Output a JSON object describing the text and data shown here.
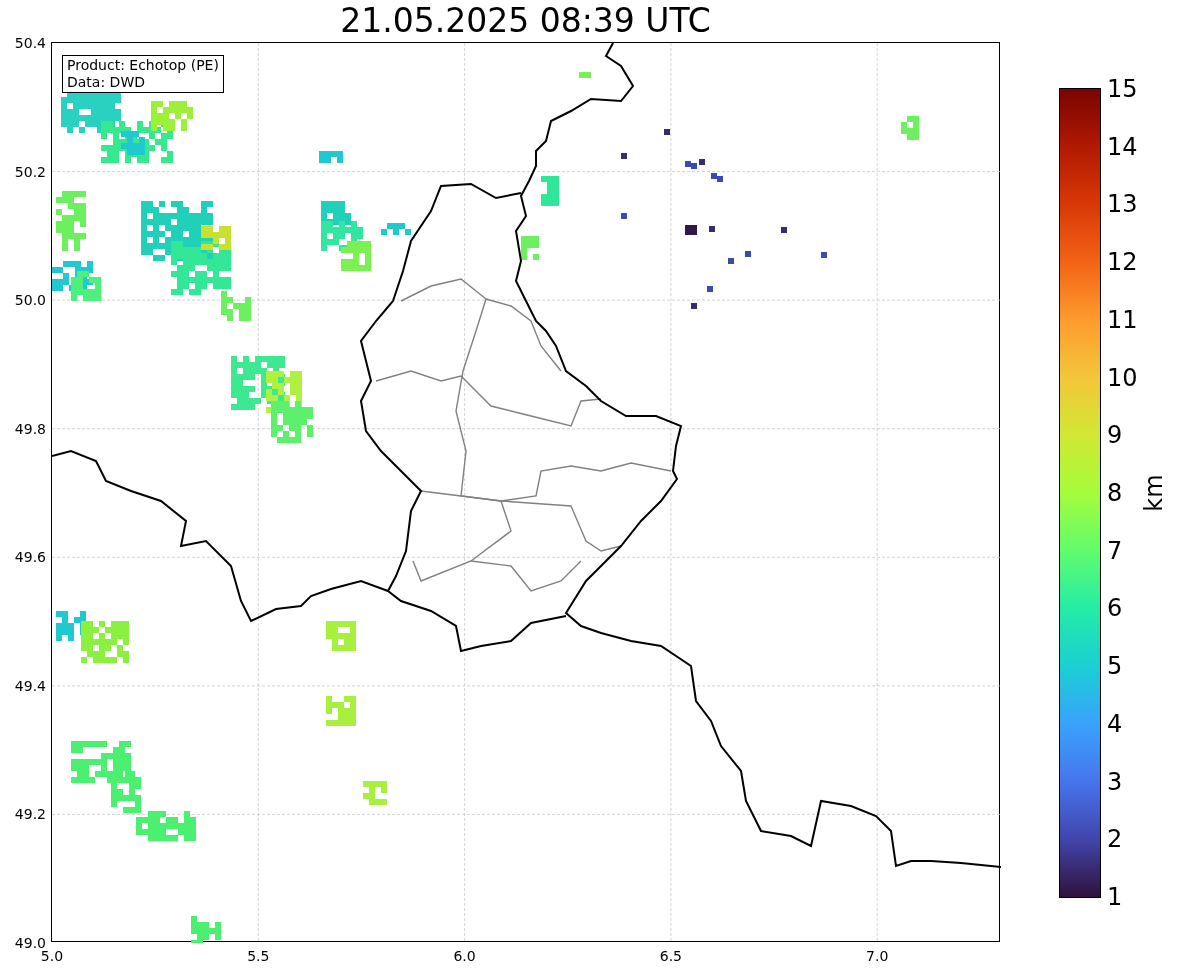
{
  "title": "21.05.2025 08:39 UTC",
  "annotation": [
    "Product: Echotop (PE)",
    "Data: DWD"
  ],
  "map": {
    "x_ticks": [
      "5.0",
      "5.5",
      "6.0",
      "6.5",
      "7.0"
    ],
    "y_ticks": [
      "50.4",
      "50.2",
      "50.0",
      "49.8",
      "49.6",
      "49.4",
      "49.2",
      "49.0"
    ]
  },
  "colorbar": {
    "label": "km",
    "ticks": [
      "15",
      "14",
      "13",
      "12",
      "11",
      "10",
      "9",
      "8",
      "7",
      "6",
      "5",
      "4",
      "3",
      "2",
      "1"
    ]
  }
}
